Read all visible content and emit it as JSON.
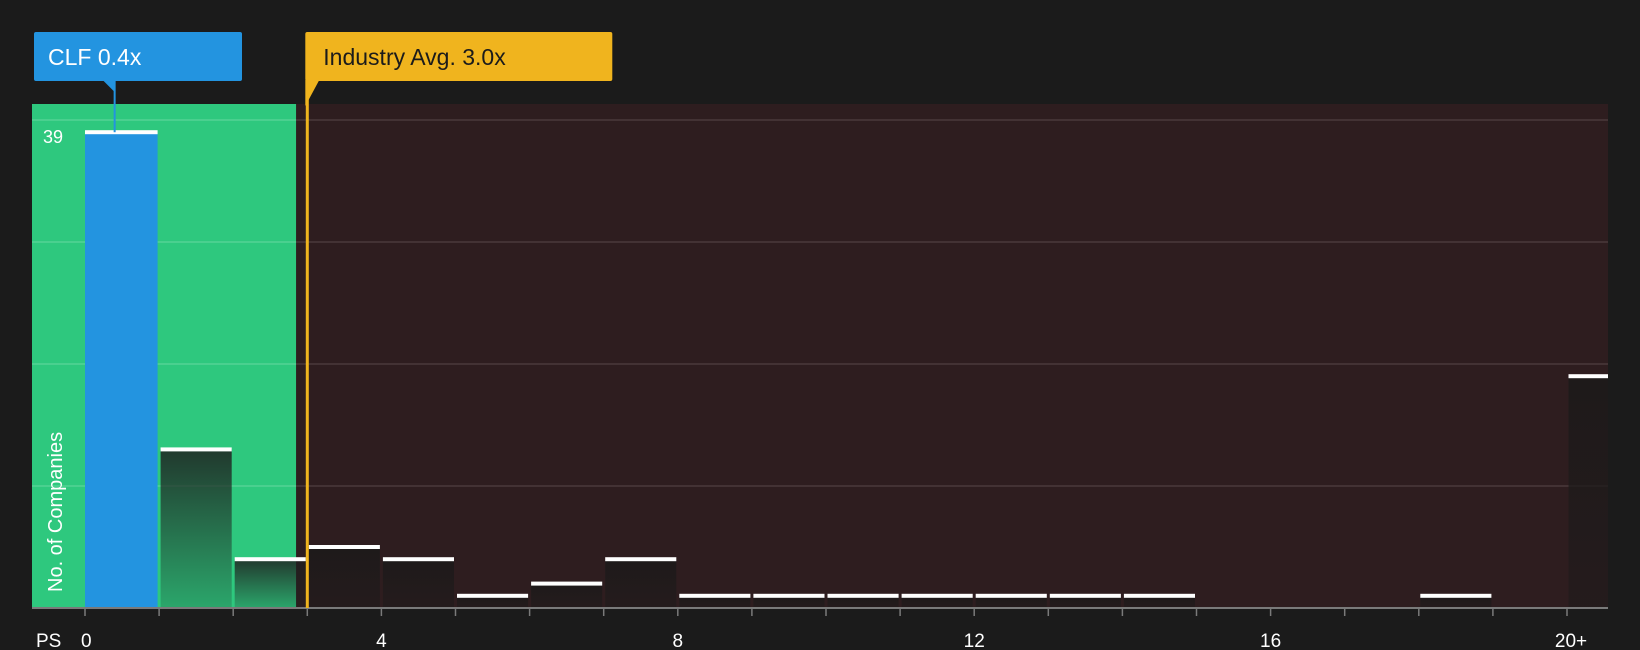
{
  "chart_data": {
    "type": "bar",
    "x_axis_name": "PS",
    "ylabel": "No. of Companies",
    "max_label": "39",
    "bin_width": 1,
    "x_ticks": [
      {
        "value": 0,
        "label": "0"
      },
      {
        "value": 4,
        "label": "4"
      },
      {
        "value": 8,
        "label": "8"
      },
      {
        "value": 12,
        "label": "12"
      },
      {
        "value": 16,
        "label": "16"
      },
      {
        "value": 20,
        "label": "20+"
      }
    ],
    "bins": [
      {
        "start": 0,
        "count": 39
      },
      {
        "start": 1,
        "count": 13
      },
      {
        "start": 2,
        "count": 4
      },
      {
        "start": 3,
        "count": 5
      },
      {
        "start": 4,
        "count": 4
      },
      {
        "start": 5,
        "count": 1
      },
      {
        "start": 6,
        "count": 2
      },
      {
        "start": 7,
        "count": 4
      },
      {
        "start": 8,
        "count": 1
      },
      {
        "start": 9,
        "count": 1
      },
      {
        "start": 10,
        "count": 1
      },
      {
        "start": 11,
        "count": 1
      },
      {
        "start": 12,
        "count": 1
      },
      {
        "start": 13,
        "count": 1
      },
      {
        "start": 14,
        "count": 1
      },
      {
        "start": 15,
        "count": 0
      },
      {
        "start": 16,
        "count": 0
      },
      {
        "start": 17,
        "count": 0
      },
      {
        "start": 18,
        "count": 1
      },
      {
        "start": 19,
        "count": 0
      },
      {
        "start": 20,
        "count": 19
      }
    ],
    "xlim": [
      0,
      20.5
    ],
    "ylim": [
      0,
      40
    ],
    "y_gridlines": [
      10,
      20,
      30,
      40
    ],
    "company": {
      "label": "CLF 0.4x",
      "value": 0.4
    },
    "industry": {
      "label": "Industry Avg. 3.0x",
      "value": 3.0
    },
    "undervalued_range": [
      -0.7,
      2.85
    ],
    "colors": {
      "background": "#1b1b1b",
      "undervalued_zone": "#2ec87e",
      "overvalued_zone": "#2e1d1f",
      "company_bar": "#2394e0",
      "company_callout": "#2394e0",
      "industry_line": "#f0b41e",
      "industry_callout": "#f0b41e",
      "bar_cap": "#ffffff",
      "gridline": "#4a3a3c",
      "axis": "#7a7a7a"
    }
  }
}
